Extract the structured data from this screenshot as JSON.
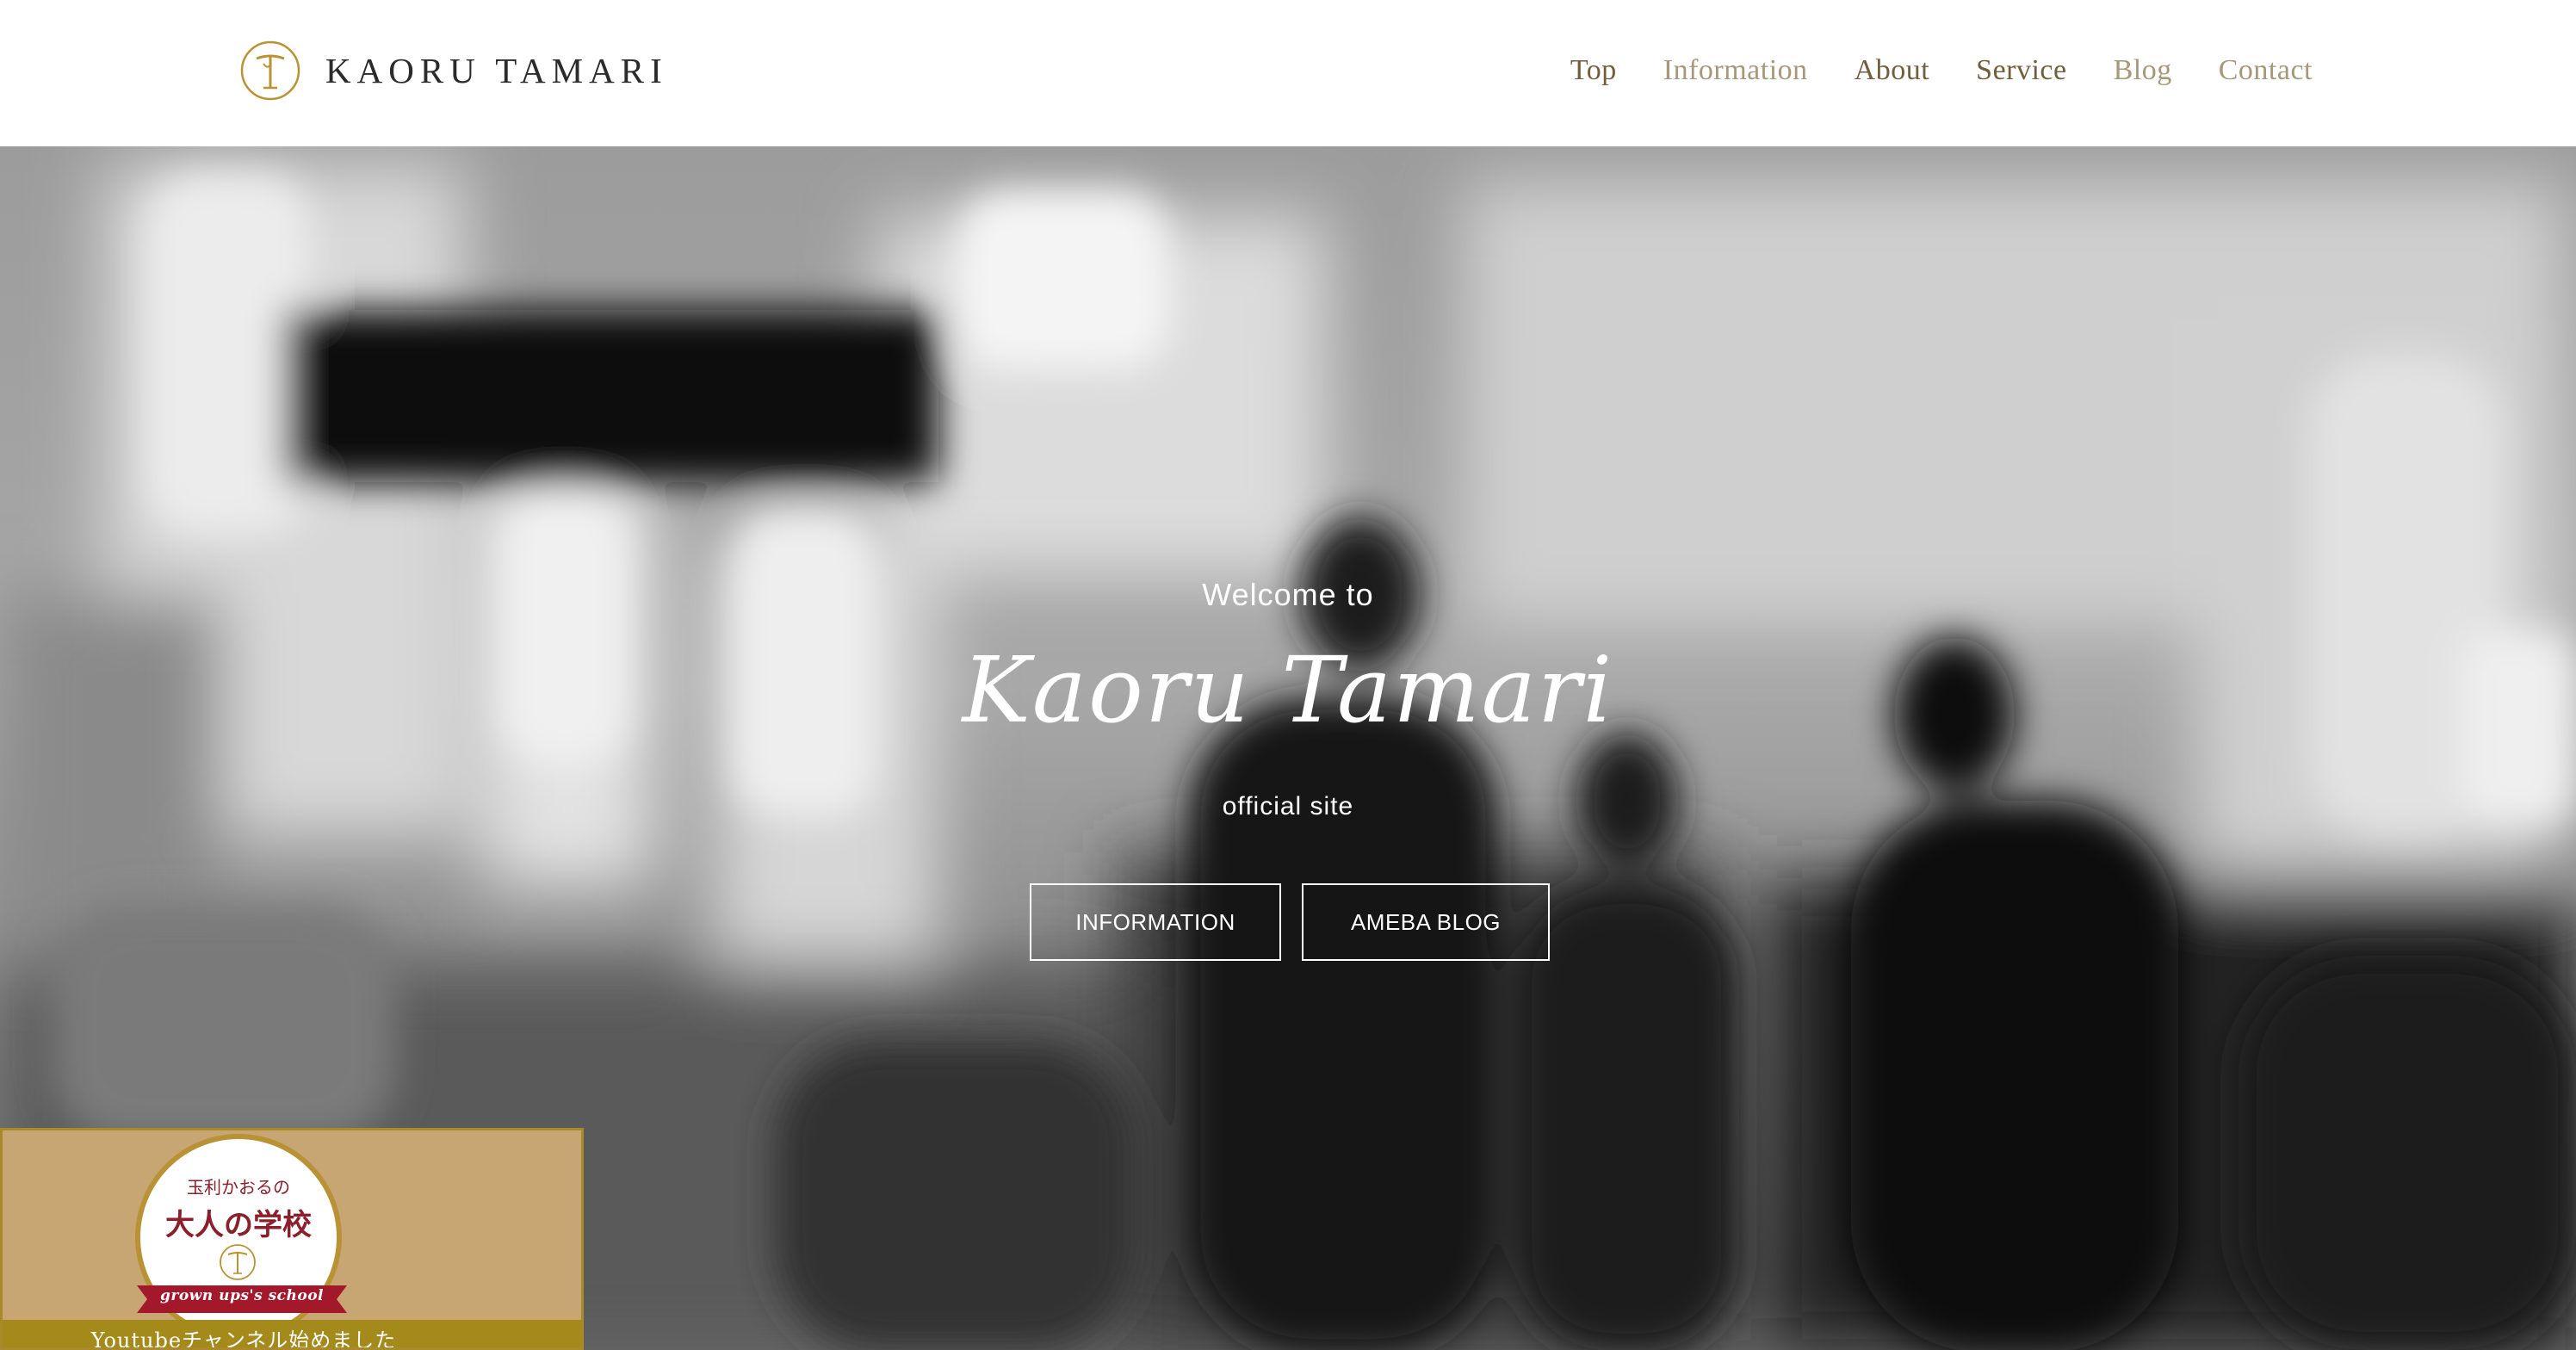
{
  "header": {
    "logo_text": "KAORU TAMARI",
    "nav": [
      {
        "label": "Top"
      },
      {
        "label": "Information"
      },
      {
        "label": "About"
      },
      {
        "label": "Service"
      },
      {
        "label": "Blog"
      },
      {
        "label": "Contact"
      }
    ]
  },
  "hero": {
    "welcome": "Welcome to",
    "title": "Kaoru Tamari",
    "subtitle": "official site",
    "buttons": [
      {
        "label": "INFORMATION"
      },
      {
        "label": "AMEBA BLOG"
      }
    ]
  },
  "banner": {
    "line1": "玉利かおるの",
    "line2": "大人の学校",
    "ribbon": "grown ups's school",
    "footer": "Youtubeチャンネル始めました"
  },
  "colors": {
    "accent_gold": "#b99235",
    "nav_dark": "#6f5f3c",
    "nav_light": "#a6987a",
    "banner_bg": "#c7a673",
    "ribbon_red": "#a3192b"
  }
}
